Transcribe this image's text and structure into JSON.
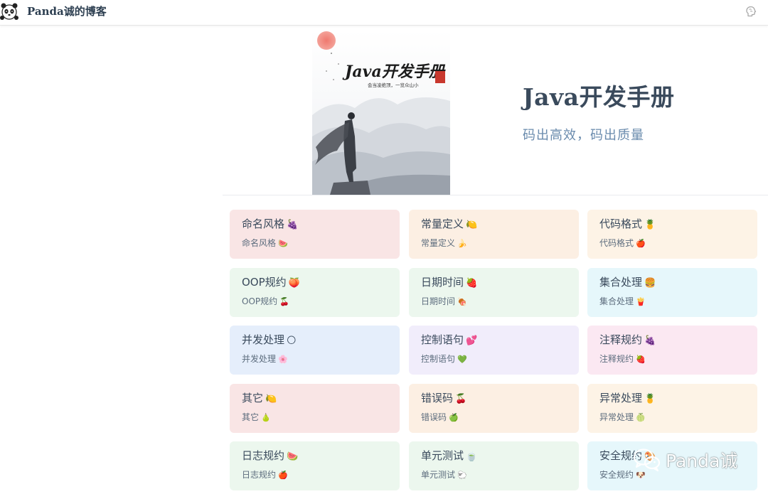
{
  "header": {
    "site_title": "Panda诚的博客",
    "logo_icon": "panda-logo",
    "right_icon": "brain-icon"
  },
  "hero": {
    "image_text": "Java开发手册",
    "image_subtext": "会当凌绝顶，一览众山小",
    "title": "Java开发手册",
    "description": "码出高效，码出质量"
  },
  "features": [
    {
      "title": "命名风格",
      "title_emoji": "🍇",
      "sub": "命名风格",
      "sub_emoji": "🍉",
      "bg": "#f9e5e5"
    },
    {
      "title": "常量定义",
      "title_emoji": "🍋",
      "sub": "常量定义",
      "sub_emoji": "🍌",
      "bg": "#fcefe3"
    },
    {
      "title": "代码格式",
      "title_emoji": "🍍",
      "sub": "代码格式",
      "sub_emoji": "🍎",
      "bg": "#fdf3e6"
    },
    {
      "title": "OOP规约",
      "title_emoji": "🍑",
      "sub": "OOP规约",
      "sub_emoji": "🍒",
      "bg": "#ecf7ee"
    },
    {
      "title": "日期时间",
      "title_emoji": "🍓",
      "sub": "日期时间",
      "sub_emoji": "🍖",
      "bg": "#ecf7ee"
    },
    {
      "title": "集合处理",
      "title_emoji": "🍔",
      "sub": "集合处理",
      "sub_emoji": "🍟",
      "bg": "#e6f7fb"
    },
    {
      "title": "并发处理",
      "title_emoji": "🌕",
      "sub": "并发处理",
      "sub_emoji": "🌸",
      "bg": "#e5eefb"
    },
    {
      "title": "控制语句",
      "title_emoji": "💕",
      "sub": "控制语句",
      "sub_emoji": "💚",
      "bg": "#f1edfb"
    },
    {
      "title": "注释规约",
      "title_emoji": "🍇",
      "sub": "注释规约",
      "sub_emoji": "🍓",
      "bg": "#fbe8f2"
    },
    {
      "title": "其它",
      "title_emoji": "🍋",
      "sub": "其它",
      "sub_emoji": "🍐",
      "bg": "#f9e5e5"
    },
    {
      "title": "错误码",
      "title_emoji": "🍒",
      "sub": "错误码",
      "sub_emoji": "🍏",
      "bg": "#fcefe3"
    },
    {
      "title": "异常处理",
      "title_emoji": "🍍",
      "sub": "异常处理",
      "sub_emoji": "🍈",
      "bg": "#fdf3e6"
    },
    {
      "title": "日志规约",
      "title_emoji": "🍉",
      "sub": "日志规约",
      "sub_emoji": "🍎",
      "bg": "#ecf7ee"
    },
    {
      "title": "单元测试",
      "title_emoji": "🍵",
      "sub": "单元测试",
      "sub_emoji": "🐑",
      "bg": "#ecf7ee"
    },
    {
      "title": "安全规约",
      "title_emoji": "🎨",
      "sub": "安全规约",
      "sub_emoji": "🐶",
      "bg": "#e6f7fb"
    }
  ],
  "watermark": {
    "text": "Panda诚",
    "icon": "wechat-icon"
  }
}
